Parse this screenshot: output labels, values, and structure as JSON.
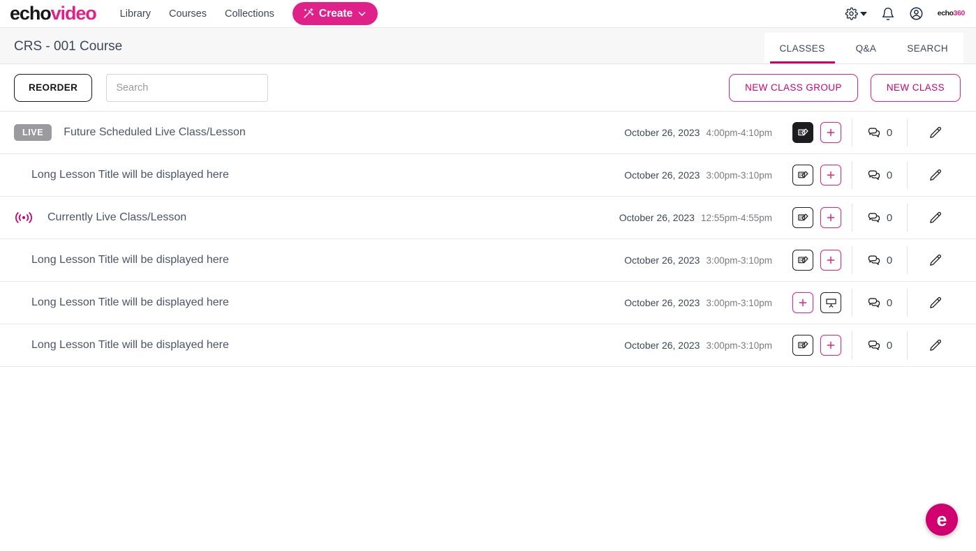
{
  "brand": {
    "part1": "echo",
    "part2": "video"
  },
  "nav": {
    "links": [
      {
        "label": "Library"
      },
      {
        "label": "Courses"
      },
      {
        "label": "Collections"
      }
    ],
    "create_label": "Create",
    "org_logo": {
      "part1": "echo",
      "part2": "360"
    }
  },
  "header": {
    "course_title": "CRS - 001 Course",
    "tabs": [
      {
        "label": "CLASSES",
        "active": true
      },
      {
        "label": "Q&A",
        "active": false
      },
      {
        "label": "SEARCH",
        "active": false
      }
    ]
  },
  "toolbar": {
    "reorder_label": "REORDER",
    "search_placeholder": "Search",
    "search_value": "",
    "new_class_group_label": "NEW CLASS GROUP",
    "new_class_label": "NEW CLASS"
  },
  "colors": {
    "brand_pink": "#e0218a",
    "accent_pink": "#d0006f",
    "live_badge_gray": "#9b9b9f",
    "text": "#3c4858"
  },
  "classes": [
    {
      "badge": "LIVE",
      "live_now": false,
      "title": "Future Scheduled Live Class/Lesson",
      "date": "October 26, 2023",
      "time": "4:00pm-4:10pm",
      "media_button": "filled",
      "second_button": "plus",
      "comments": "0"
    },
    {
      "badge": "",
      "live_now": false,
      "title": "Long Lesson Title will be displayed here",
      "date": "October 26, 2023",
      "time": "3:00pm-3:10pm",
      "media_button": "outline",
      "second_button": "plus",
      "comments": "0"
    },
    {
      "badge": "",
      "live_now": true,
      "title": "Currently Live Class/Lesson",
      "date": "October 26, 2023",
      "time": "12:55pm-4:55pm",
      "media_button": "outline",
      "second_button": "plus",
      "comments": "0"
    },
    {
      "badge": "",
      "live_now": false,
      "title": "Long Lesson Title will be displayed here",
      "date": "October 26, 2023",
      "time": "3:00pm-3:10pm",
      "media_button": "outline",
      "second_button": "plus",
      "comments": "0"
    },
    {
      "badge": "",
      "live_now": false,
      "title": "Long Lesson Title will be displayed here",
      "date": "October 26, 2023",
      "time": "3:00pm-3:10pm",
      "media_button": "plus-first",
      "second_button": "presentation",
      "comments": "0"
    },
    {
      "badge": "",
      "live_now": false,
      "title": "Long Lesson Title will be displayed here",
      "date": "October 26, 2023",
      "time": "3:00pm-3:10pm",
      "media_button": "outline",
      "second_button": "plus",
      "comments": "0"
    }
  ],
  "chat": {
    "label": "e"
  }
}
